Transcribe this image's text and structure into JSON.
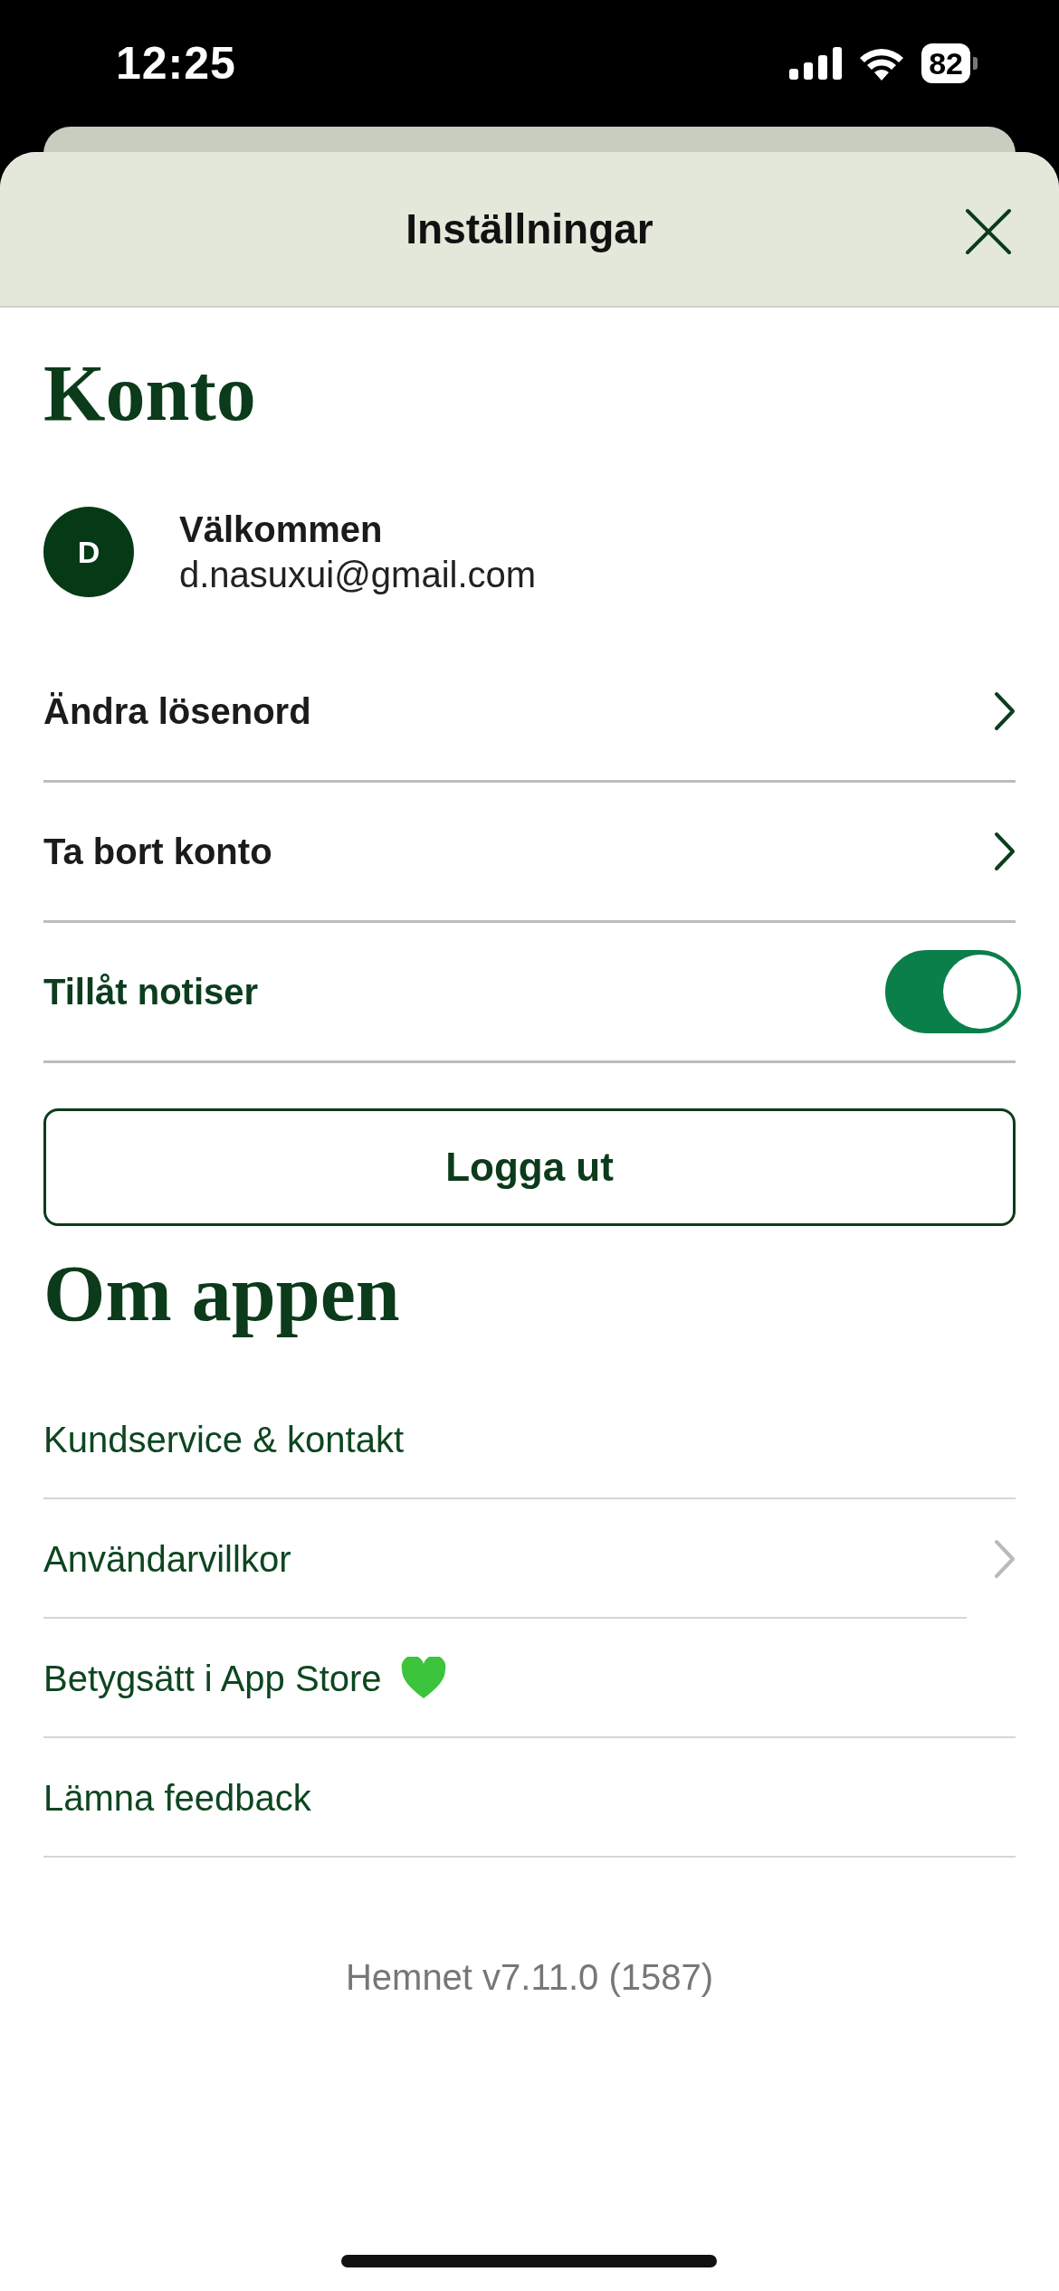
{
  "status_bar": {
    "time": "12:25",
    "battery": "82"
  },
  "header": {
    "title": "Inställningar"
  },
  "account": {
    "heading": "Konto",
    "user": {
      "initial": "D",
      "greeting": "Välkommen",
      "email": "d.nasuxui@gmail.com"
    },
    "rows": [
      {
        "kind": "link",
        "label": "Ändra lösenord"
      },
      {
        "kind": "link",
        "label": "Ta bort konto"
      },
      {
        "kind": "toggle",
        "label": "Tillåt notiser",
        "on": true
      }
    ],
    "logout": "Logga ut"
  },
  "about": {
    "heading": "Om appen",
    "items": [
      {
        "kind": "link",
        "label": "Kundservice & kontakt"
      },
      {
        "kind": "page",
        "label": "Användarvillkor"
      },
      {
        "kind": "rating",
        "label": "Betygsätt i App Store"
      },
      {
        "kind": "link",
        "label": "Lämna feedback"
      }
    ]
  },
  "version": "Hemnet v7.11.0 (1587)"
}
